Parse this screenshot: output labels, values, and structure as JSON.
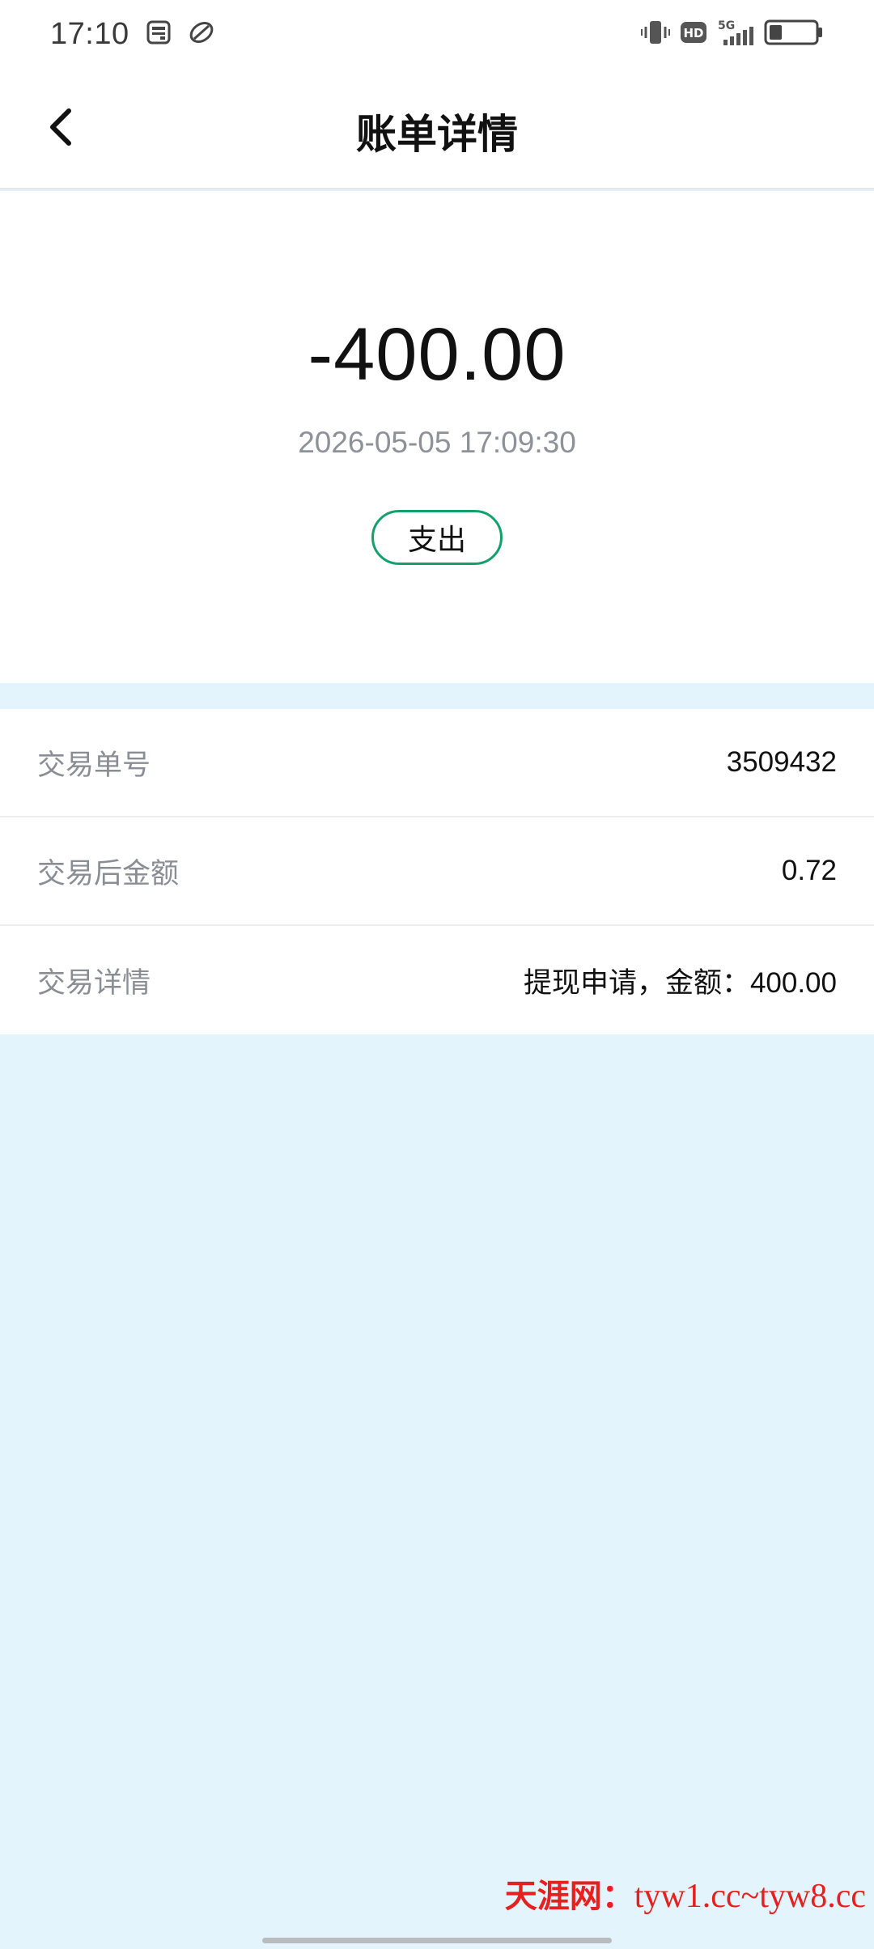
{
  "status_bar": {
    "time": "17:10",
    "network": "5G",
    "hd": "HD",
    "left_icons": [
      "sim-card-icon",
      "leaf-app-icon"
    ],
    "right_icons": [
      "vibrate-icon",
      "hd-icon",
      "signal-5g-icon",
      "battery-icon"
    ],
    "battery_level": 0.25
  },
  "header": {
    "title": "账单详情",
    "back_icon": "chevron-left-icon"
  },
  "summary": {
    "amount": "-400.00",
    "datetime": "2026-05-05 17:09:30",
    "type": "支出",
    "badge_color": "#12a06b"
  },
  "details": [
    {
      "label": "交易单号",
      "value": "3509432"
    },
    {
      "label": "交易后金额",
      "value": "0.72"
    },
    {
      "label": "交易详情",
      "value": "提现申请，金额：400.00"
    }
  ],
  "watermark": {
    "name": "天涯网：",
    "url": "tyw1.cc~tyw8.cc",
    "color": "#e5201f"
  },
  "colors": {
    "background": "#e3f4fd",
    "card": "#ffffff"
  }
}
